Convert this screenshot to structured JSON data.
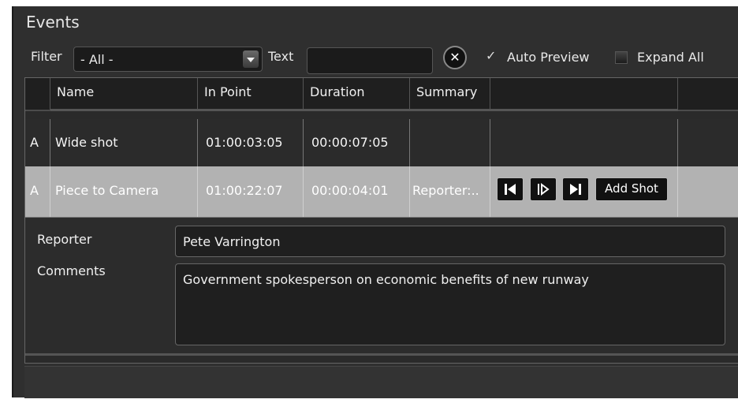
{
  "panel": {
    "title": "Events"
  },
  "toolbar": {
    "filter_label": "Filter",
    "filter_value": "- All -",
    "text_label": "Text",
    "text_value": "",
    "auto_preview_label": "Auto Preview",
    "auto_preview_checked": true,
    "expand_all_label": "Expand All",
    "expand_all_checked": false
  },
  "grid": {
    "columns": [
      "Name",
      "In Point",
      "Duration",
      "Summary"
    ],
    "rows": [
      {
        "type": "A",
        "name": "Wide shot",
        "in_point": "01:00:03:05",
        "duration": "00:00:07:05",
        "summary": ""
      },
      {
        "type": "A",
        "name": "Piece to Camera",
        "in_point": "01:00:22:07",
        "duration": "00:00:04:01",
        "summary": "Reporter:..",
        "selected": true
      }
    ],
    "row_actions": {
      "add_shot_label": "Add Shot"
    },
    "detail": {
      "reporter_label": "Reporter",
      "reporter_value": "Pete Varrington",
      "comments_label": "Comments",
      "comments_value": "Government spokesperson on economic benefits of new runway"
    }
  },
  "icons": {
    "clear": "clear-x-icon",
    "skip_start": "skip-to-start-icon",
    "step": "step-play-icon",
    "skip_end": "skip-to-end-icon"
  }
}
